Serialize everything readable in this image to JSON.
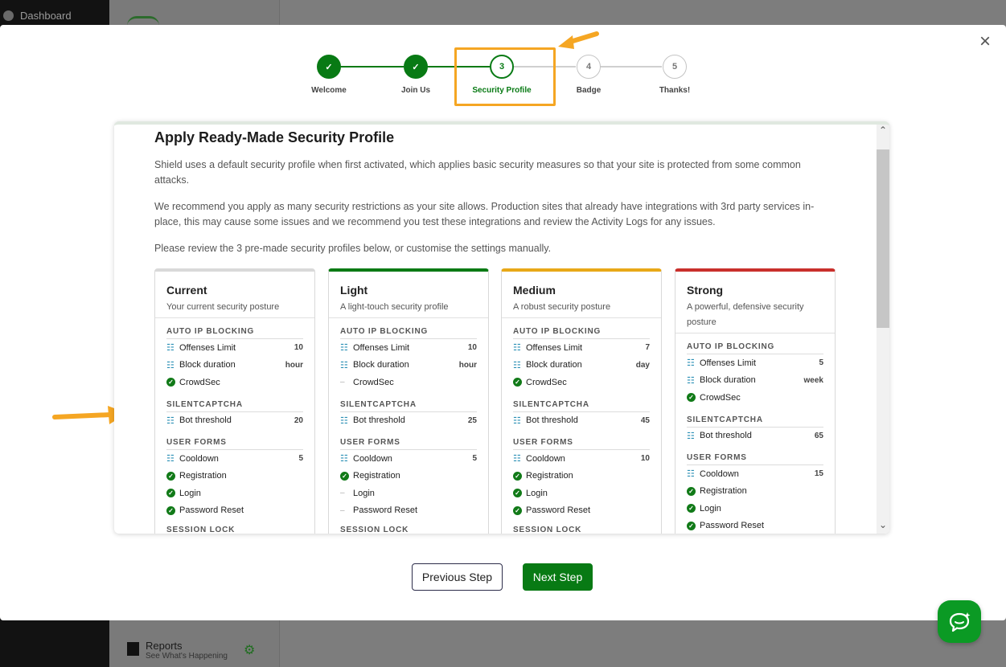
{
  "background": {
    "sidebar_dashboard": "Dashboard",
    "reports_title": "Reports",
    "reports_sub": "See What's Happening"
  },
  "stepper": {
    "steps": [
      {
        "num": "✓",
        "label": "Welcome",
        "state": "done"
      },
      {
        "num": "✓",
        "label": "Join Us",
        "state": "done"
      },
      {
        "num": "3",
        "label": "Security Profile",
        "state": "active"
      },
      {
        "num": "4",
        "label": "Badge",
        "state": "todo"
      },
      {
        "num": "5",
        "label": "Thanks!",
        "state": "todo"
      }
    ]
  },
  "content": {
    "title": "Apply Ready-Made Security Profile",
    "para1": "Shield uses a default security profile when first activated, which applies basic security measures so that your site is protected from some common attacks.",
    "para2": "We recommend you apply as many security restrictions as your site allows. Production sites that already have integrations with 3rd party services in-place, this may cause some issues and we recommend you test these integrations and review the Activity Logs for any issues.",
    "para3": "Please review the 3 pre-made security profiles below, or customise the settings manually."
  },
  "cards": [
    {
      "title": "Current",
      "sub": "Your current security posture",
      "accent": "#d9d9d9",
      "auto_ip": "AUTO IP BLOCKING",
      "offenses": "Offenses Limit",
      "offenses_val": "10",
      "block": "Block duration",
      "block_val": "hour",
      "crowdsec": "CrowdSec",
      "crowdsec_on": true,
      "captcha": "SILENTCAPTCHA",
      "bot": "Bot threshold",
      "bot_val": "20",
      "forms": "USER FORMS",
      "cooldown": "Cooldown",
      "cooldown_val": "5",
      "registration": "Registration",
      "reg_on": true,
      "login": "Login",
      "login_on": true,
      "reset": "Password Reset",
      "reset_on": true,
      "session": "SESSION LOCK"
    },
    {
      "title": "Light",
      "sub": "A light-touch security profile",
      "accent": "#087a14",
      "auto_ip": "AUTO IP BLOCKING",
      "offenses": "Offenses Limit",
      "offenses_val": "10",
      "block": "Block duration",
      "block_val": "hour",
      "crowdsec": "CrowdSec",
      "crowdsec_on": false,
      "captcha": "SILENTCAPTCHA",
      "bot": "Bot threshold",
      "bot_val": "25",
      "forms": "USER FORMS",
      "cooldown": "Cooldown",
      "cooldown_val": "5",
      "registration": "Registration",
      "reg_on": true,
      "login": "Login",
      "login_on": false,
      "reset": "Password Reset",
      "reset_on": false,
      "session": "SESSION LOCK"
    },
    {
      "title": "Medium",
      "sub": "A robust security posture",
      "accent": "#e8a818",
      "auto_ip": "AUTO IP BLOCKING",
      "offenses": "Offenses Limit",
      "offenses_val": "7",
      "block": "Block duration",
      "block_val": "day",
      "crowdsec": "CrowdSec",
      "crowdsec_on": true,
      "captcha": "SILENTCAPTCHA",
      "bot": "Bot threshold",
      "bot_val": "45",
      "forms": "USER FORMS",
      "cooldown": "Cooldown",
      "cooldown_val": "10",
      "registration": "Registration",
      "reg_on": true,
      "login": "Login",
      "login_on": true,
      "reset": "Password Reset",
      "reset_on": true,
      "session": "SESSION LOCK"
    },
    {
      "title": "Strong",
      "sub": "A powerful, defensive security posture",
      "accent": "#c9302c",
      "auto_ip": "AUTO IP BLOCKING",
      "offenses": "Offenses Limit",
      "offenses_val": "5",
      "block": "Block duration",
      "block_val": "week",
      "crowdsec": "CrowdSec",
      "crowdsec_on": true,
      "captcha": "SILENTCAPTCHA",
      "bot": "Bot threshold",
      "bot_val": "65",
      "forms": "USER FORMS",
      "cooldown": "Cooldown",
      "cooldown_val": "15",
      "registration": "Registration",
      "reg_on": true,
      "login": "Login",
      "login_on": true,
      "reset": "Password Reset",
      "reset_on": true,
      "session": ""
    }
  ],
  "footer": {
    "prev_label": "Previous Step",
    "next_label": "Next Step"
  },
  "colors": {
    "primary": "#087a14",
    "highlight": "#f5a623"
  },
  "icons": {
    "close": "close-icon",
    "chat": "chat-icon",
    "tune": "sliders-icon",
    "check": "check-circle-icon"
  }
}
